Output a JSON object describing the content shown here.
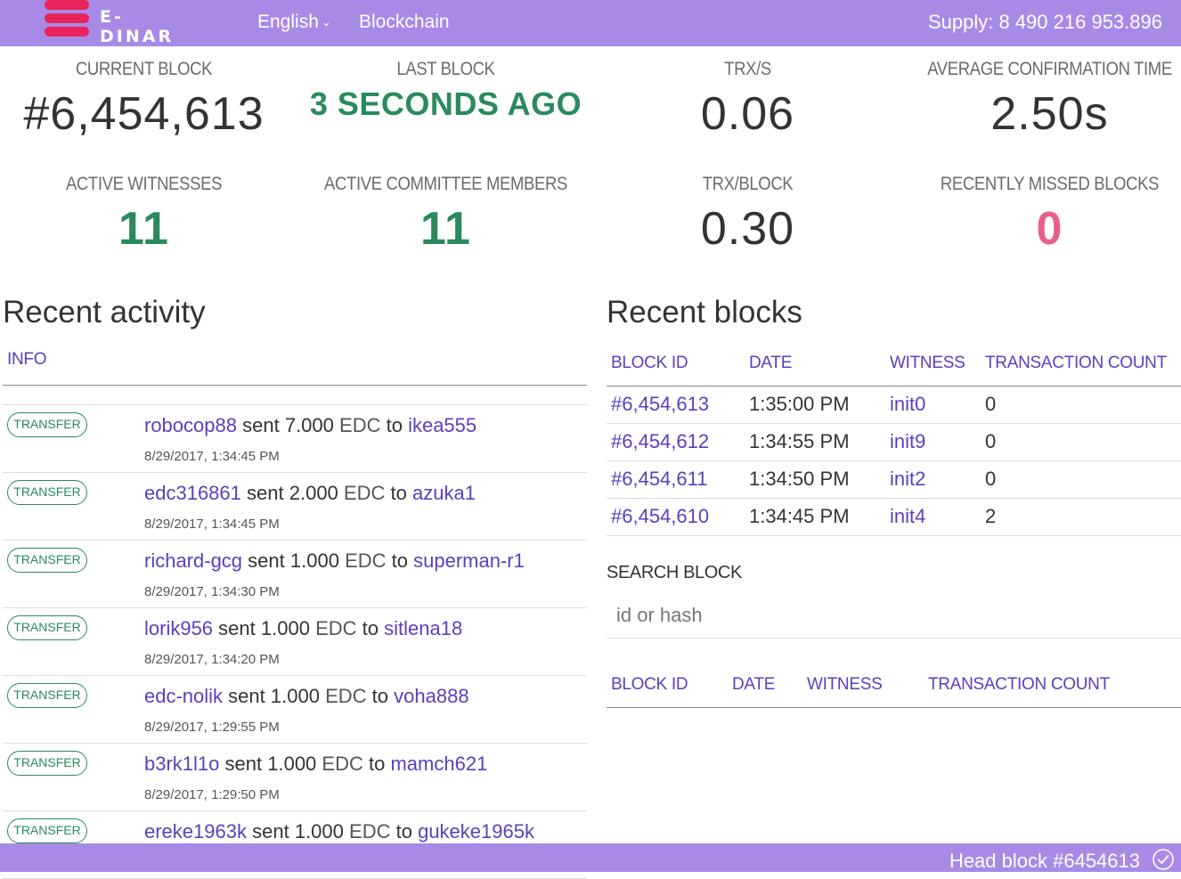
{
  "header": {
    "logo_text": "E-DINAR",
    "language": "English",
    "blockchain_link": "Blockchain",
    "supply": "Supply: 8 490 216 953.896"
  },
  "stats": {
    "current_block": {
      "label": "CURRENT BLOCK",
      "value": "#6,454,613"
    },
    "last_block": {
      "label": "LAST BLOCK",
      "value": "3 SECONDS AGO"
    },
    "trx_per_s": {
      "label": "TRX/S",
      "value": "0.06"
    },
    "avg_confirmation": {
      "label": "AVERAGE CONFIRMATION TIME",
      "value": "2.50s"
    },
    "active_witnesses": {
      "label": "ACTIVE WITNESSES",
      "value": "11"
    },
    "active_committee": {
      "label": "ACTIVE COMMITTEE MEMBERS",
      "value": "11"
    },
    "trx_per_block": {
      "label": "TRX/BLOCK",
      "value": "0.30"
    },
    "missed_blocks": {
      "label": "RECENTLY MISSED BLOCKS",
      "value": "0"
    }
  },
  "activity": {
    "title": "Recent activity",
    "column_info": "INFO",
    "items": [
      {
        "type": "TRANSFER",
        "from": "robocop88",
        "verb": "sent",
        "amount": "7.000",
        "currency": "EDC",
        "prep": "to",
        "to": "ikea555",
        "time": "8/29/2017, 1:34:45 PM"
      },
      {
        "type": "TRANSFER",
        "from": "edc316861",
        "verb": "sent",
        "amount": "2.000",
        "currency": "EDC",
        "prep": "to",
        "to": "azuka1",
        "time": "8/29/2017, 1:34:45 PM"
      },
      {
        "type": "TRANSFER",
        "from": "richard-gcg",
        "verb": "sent",
        "amount": "1.000",
        "currency": "EDC",
        "prep": "to",
        "to": "superman-r1",
        "time": "8/29/2017, 1:34:30 PM"
      },
      {
        "type": "TRANSFER",
        "from": "lorik956",
        "verb": "sent",
        "amount": "1.000",
        "currency": "EDC",
        "prep": "to",
        "to": "sitlena18",
        "time": "8/29/2017, 1:34:20 PM"
      },
      {
        "type": "TRANSFER",
        "from": "edc-nolik",
        "verb": "sent",
        "amount": "1.000",
        "currency": "EDC",
        "prep": "to",
        "to": "voha888",
        "time": "8/29/2017, 1:29:55 PM"
      },
      {
        "type": "TRANSFER",
        "from": "b3rk1l1o",
        "verb": "sent",
        "amount": "1.000",
        "currency": "EDC",
        "prep": "to",
        "to": "mamch621",
        "time": "8/29/2017, 1:29:50 PM"
      },
      {
        "type": "TRANSFER",
        "from": "ereke1963k",
        "verb": "sent",
        "amount": "1.000",
        "currency": "EDC",
        "prep": "to",
        "to": "gukeke1965k",
        "time": ""
      }
    ]
  },
  "blocks": {
    "title": "Recent blocks",
    "columns": [
      "BLOCK ID",
      "DATE",
      "WITNESS",
      "TRANSACTION COUNT"
    ],
    "rows": [
      {
        "id": "#6,454,613",
        "date": "1:35:00 PM",
        "witness": "init0",
        "count": "0"
      },
      {
        "id": "#6,454,612",
        "date": "1:34:55 PM",
        "witness": "init9",
        "count": "0"
      },
      {
        "id": "#6,454,611",
        "date": "1:34:50 PM",
        "witness": "init2",
        "count": "0"
      },
      {
        "id": "#6,454,610",
        "date": "1:34:45 PM",
        "witness": "init4",
        "count": "2"
      }
    ]
  },
  "search": {
    "label": "SEARCH BLOCK",
    "placeholder": "id or hash",
    "value": "",
    "columns": [
      "BLOCK ID",
      "DATE",
      "WITNESS",
      "TRANSACTION COUNT"
    ]
  },
  "footer": {
    "head_block": "Head block #6454613",
    "status_icon": "check-circle-icon"
  },
  "colors": {
    "brand_purple": "#a78ae6",
    "link_purple": "#5a3fc0",
    "green": "#2a8a5e",
    "pink": "#e8608a",
    "logo_red": "#e8245a"
  }
}
